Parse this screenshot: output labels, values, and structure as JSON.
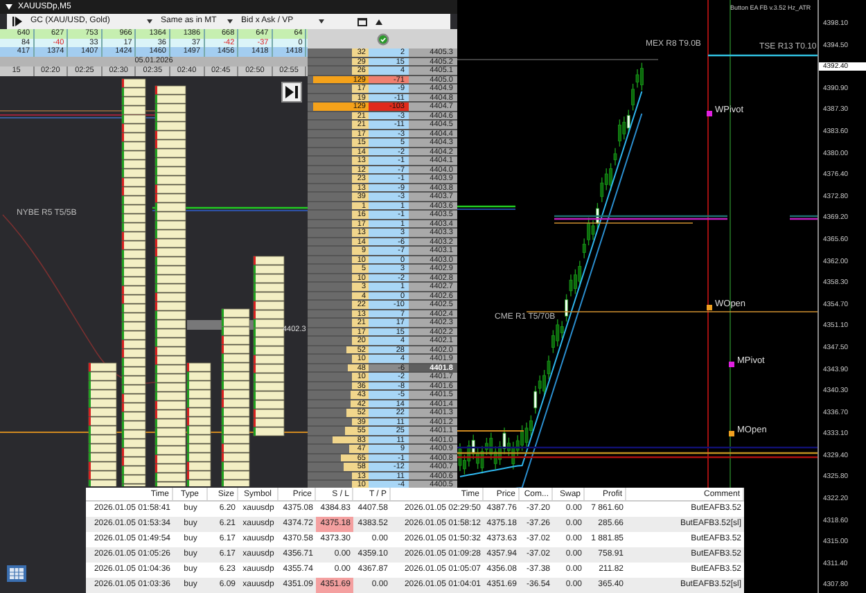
{
  "window": {
    "title": "XAUUSDp,M5"
  },
  "toolbar": {
    "instrument": "GC (XAU/USD, Gold)",
    "time_mode": "Same as in MT",
    "display_mode": "Bid x Ask / VP"
  },
  "stats": {
    "volume": [
      "640",
      "627",
      "753",
      "966",
      "1364",
      "1386",
      "668",
      "647",
      "64"
    ],
    "delta": [
      "84",
      "-40",
      "33",
      "17",
      "36",
      "37",
      "-42",
      "-37",
      "0"
    ],
    "cumulative": [
      "417",
      "1374",
      "1407",
      "1424",
      "1460",
      "1497",
      "1456",
      "1418",
      "1418"
    ]
  },
  "date": "05.01.2026",
  "times": [
    "15",
    "02:20",
    "02:25",
    "02:30",
    "02:35",
    "02:40",
    "02:45",
    "02:50",
    "02:55"
  ],
  "footprint": {
    "price_marker": "4402.3",
    "label": "NYBE R5 T5/5B"
  },
  "ladder": [
    {
      "volume": "32",
      "delta": "2",
      "price": "4405.3",
      "selected": false
    },
    {
      "volume": "29",
      "delta": "15",
      "price": "4405.2",
      "selected": false
    },
    {
      "volume": "26",
      "delta": "4",
      "price": "4405.1",
      "selected": false
    },
    {
      "volume": "129",
      "delta": "-71",
      "price": "4405.0",
      "selected": false
    },
    {
      "volume": "17",
      "delta": "-9",
      "price": "4404.9",
      "selected": false
    },
    {
      "volume": "19",
      "delta": "-11",
      "price": "4404.8",
      "selected": false
    },
    {
      "volume": "129",
      "delta": "-103",
      "price": "4404.7",
      "selected": false
    },
    {
      "volume": "21",
      "delta": "-3",
      "price": "4404.6",
      "selected": false
    },
    {
      "volume": "21",
      "delta": "-11",
      "price": "4404.5",
      "selected": false
    },
    {
      "volume": "17",
      "delta": "-3",
      "price": "4404.4",
      "selected": false
    },
    {
      "volume": "15",
      "delta": "5",
      "price": "4404.3",
      "selected": false
    },
    {
      "volume": "14",
      "delta": "-2",
      "price": "4404.2",
      "selected": false
    },
    {
      "volume": "13",
      "delta": "-1",
      "price": "4404.1",
      "selected": false
    },
    {
      "volume": "12",
      "delta": "-7",
      "price": "4404.0",
      "selected": false
    },
    {
      "volume": "23",
      "delta": "-1",
      "price": "4403.9",
      "selected": false
    },
    {
      "volume": "13",
      "delta": "-9",
      "price": "4403.8",
      "selected": false
    },
    {
      "volume": "39",
      "delta": "-3",
      "price": "4403.7",
      "selected": false
    },
    {
      "volume": "1",
      "delta": "1",
      "price": "4403.6",
      "selected": false
    },
    {
      "volume": "16",
      "delta": "-1",
      "price": "4403.5",
      "selected": false
    },
    {
      "volume": "17",
      "delta": "1",
      "price": "4403.4",
      "selected": false
    },
    {
      "volume": "13",
      "delta": "3",
      "price": "4403.3",
      "selected": false
    },
    {
      "volume": "14",
      "delta": "-6",
      "price": "4403.2",
      "selected": false
    },
    {
      "volume": "9",
      "delta": "-7",
      "price": "4403.1",
      "selected": false
    },
    {
      "volume": "10",
      "delta": "0",
      "price": "4403.0",
      "selected": false
    },
    {
      "volume": "5",
      "delta": "3",
      "price": "4402.9",
      "selected": false
    },
    {
      "volume": "10",
      "delta": "-2",
      "price": "4402.8",
      "selected": false
    },
    {
      "volume": "3",
      "delta": "1",
      "price": "4402.7",
      "selected": false
    },
    {
      "volume": "4",
      "delta": "0",
      "price": "4402.6",
      "selected": false
    },
    {
      "volume": "22",
      "delta": "-10",
      "price": "4402.5",
      "selected": false
    },
    {
      "volume": "13",
      "delta": "7",
      "price": "4402.4",
      "selected": false
    },
    {
      "volume": "21",
      "delta": "17",
      "price": "4402.3",
      "selected": false
    },
    {
      "volume": "17",
      "delta": "15",
      "price": "4402.2",
      "selected": false
    },
    {
      "volume": "20",
      "delta": "4",
      "price": "4402.1",
      "selected": false
    },
    {
      "volume": "52",
      "delta": "28",
      "price": "4402.0",
      "selected": false
    },
    {
      "volume": "10",
      "delta": "4",
      "price": "4401.9",
      "selected": false
    },
    {
      "volume": "48",
      "delta": "-6",
      "price": "4401.8",
      "selected": true
    },
    {
      "volume": "10",
      "delta": "-2",
      "price": "4401.7",
      "selected": false
    },
    {
      "volume": "36",
      "delta": "-8",
      "price": "4401.6",
      "selected": false
    },
    {
      "volume": "43",
      "delta": "-5",
      "price": "4401.5",
      "selected": false
    },
    {
      "volume": "42",
      "delta": "14",
      "price": "4401.4",
      "selected": false
    },
    {
      "volume": "52",
      "delta": "22",
      "price": "4401.3",
      "selected": false
    },
    {
      "volume": "39",
      "delta": "11",
      "price": "4401.2",
      "selected": false
    },
    {
      "volume": "55",
      "delta": "25",
      "price": "4401.1",
      "selected": false
    },
    {
      "volume": "83",
      "delta": "11",
      "price": "4401.0",
      "selected": false
    },
    {
      "volume": "47",
      "delta": "9",
      "price": "4400.9",
      "selected": false
    },
    {
      "volume": "65",
      "delta": "-1",
      "price": "4400.8",
      "selected": false
    },
    {
      "volume": "58",
      "delta": "-12",
      "price": "4400.7",
      "selected": false
    },
    {
      "volume": "13",
      "delta": "11",
      "price": "4400.6",
      "selected": false
    },
    {
      "volume": "10",
      "delta": "-4",
      "price": "4400.5",
      "selected": false
    }
  ],
  "chart": {
    "indicator": "Button EA FB v.3.52 Hz_ATR",
    "labels": [
      {
        "text": "MEX R8 T9.0B",
        "kind": "level"
      },
      {
        "text": "TSE R13 T0.10",
        "kind": "level"
      },
      {
        "text": "CME R1 T5/70B",
        "kind": "level"
      },
      {
        "text": "WPivot",
        "kind": "pivot",
        "color": "#e020e0"
      },
      {
        "text": "WOpen",
        "kind": "pivot",
        "color": "#f0a020"
      },
      {
        "text": "MPivot",
        "kind": "pivot",
        "color": "#e020e0"
      },
      {
        "text": "MOpen",
        "kind": "pivot",
        "color": "#f0a020"
      }
    ],
    "price_axis": [
      {
        "price": "4398.10",
        "selected": false
      },
      {
        "price": "4394.50",
        "selected": false
      },
      {
        "price": "4392.40",
        "selected": true
      },
      {
        "price": "4390.90",
        "selected": false
      },
      {
        "price": "4387.30",
        "selected": false
      },
      {
        "price": "4383.60",
        "selected": false
      },
      {
        "price": "4380.00",
        "selected": false
      },
      {
        "price": "4376.40",
        "selected": false
      },
      {
        "price": "4372.80",
        "selected": false
      },
      {
        "price": "4369.20",
        "selected": false
      },
      {
        "price": "4365.60",
        "selected": false
      },
      {
        "price": "4362.00",
        "selected": false
      },
      {
        "price": "4358.30",
        "selected": false
      },
      {
        "price": "4354.70",
        "selected": false
      },
      {
        "price": "4351.10",
        "selected": false
      },
      {
        "price": "4347.50",
        "selected": false
      },
      {
        "price": "4343.90",
        "selected": false
      },
      {
        "price": "4340.30",
        "selected": false
      },
      {
        "price": "4336.70",
        "selected": false
      },
      {
        "price": "4333.10",
        "selected": false
      },
      {
        "price": "4329.40",
        "selected": false
      },
      {
        "price": "4325.80",
        "selected": false
      },
      {
        "price": "4322.20",
        "selected": false
      },
      {
        "price": "4318.60",
        "selected": false
      },
      {
        "price": "4315.00",
        "selected": false
      },
      {
        "price": "4311.40",
        "selected": false
      },
      {
        "price": "4307.80",
        "selected": false
      }
    ]
  },
  "trades": {
    "columns": [
      "Time",
      "Type",
      "Size",
      "Symbol",
      "Price",
      "S / L",
      "T / P",
      "Time",
      "Price",
      "Com...",
      "Swap",
      "Profit",
      "Comment"
    ],
    "rows": [
      {
        "cells": [
          "2026.01.05 01:58:41",
          "buy",
          "6.20",
          "xauusdp",
          "4375.08",
          "4384.83",
          "4407.58",
          "2026.01.05 02:29:50",
          "4387.76",
          "-37.20",
          "0.00",
          "7 861.60",
          "ButEAFB3.52"
        ],
        "sl_hit": false
      },
      {
        "cells": [
          "2026.01.05 01:53:34",
          "buy",
          "6.21",
          "xauusdp",
          "4374.72",
          "4375.18",
          "4383.52",
          "2026.01.05 01:58:12",
          "4375.18",
          "-37.26",
          "0.00",
          "285.66",
          "ButEAFB3.52[sl]"
        ],
        "sl_hit": true
      },
      {
        "cells": [
          "2026.01.05 01:49:54",
          "buy",
          "6.17",
          "xauusdp",
          "4370.58",
          "4373.30",
          "0.00",
          "2026.01.05 01:50:32",
          "4373.63",
          "-37.02",
          "0.00",
          "1 881.85",
          "ButEAFB3.52"
        ],
        "sl_hit": false
      },
      {
        "cells": [
          "2026.01.05 01:05:26",
          "buy",
          "6.17",
          "xauusdp",
          "4356.71",
          "0.00",
          "4359.10",
          "2026.01.05 01:09:28",
          "4357.94",
          "-37.02",
          "0.00",
          "758.91",
          "ButEAFB3.52"
        ],
        "sl_hit": false
      },
      {
        "cells": [
          "2026.01.05 01:04:36",
          "buy",
          "6.23",
          "xauusdp",
          "4355.74",
          "0.00",
          "4367.87",
          "2026.01.05 01:05:07",
          "4356.08",
          "-37.38",
          "0.00",
          "211.82",
          "ButEAFB3.52"
        ],
        "sl_hit": false
      },
      {
        "cells": [
          "2026.01.05 01:03:36",
          "buy",
          "6.09",
          "xauusdp",
          "4351.09",
          "4351.69",
          "0.00",
          "2026.01.05 01:04:01",
          "4351.69",
          "-36.54",
          "0.00",
          "365.40",
          "ButEAFB3.52[sl]"
        ],
        "sl_hit": true
      }
    ]
  }
}
